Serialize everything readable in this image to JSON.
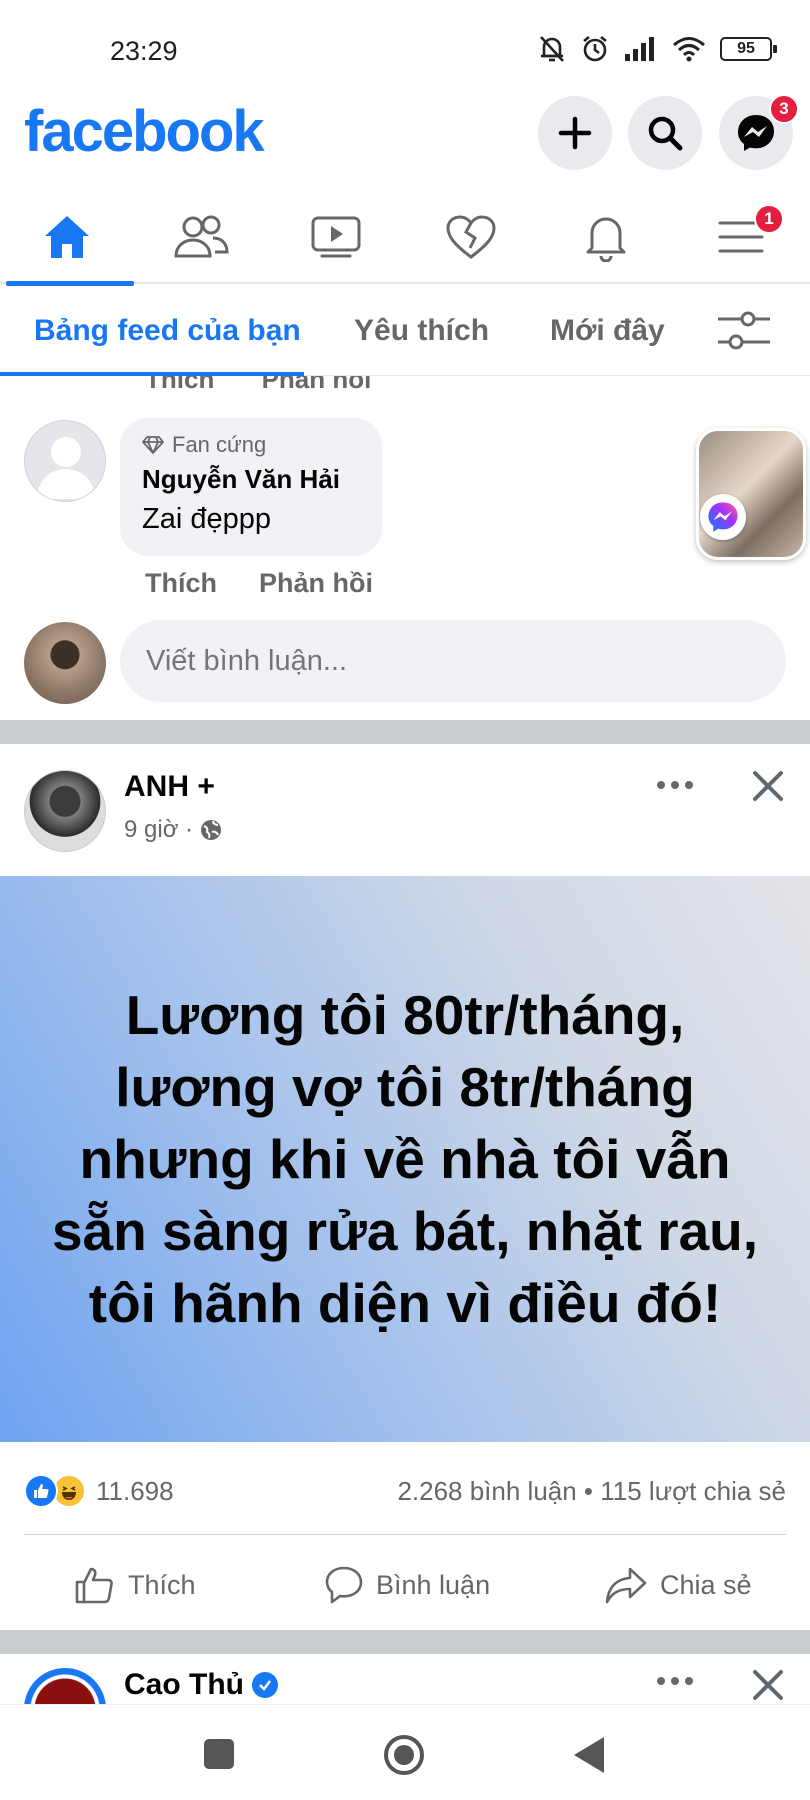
{
  "status_bar": {
    "time": "23:29",
    "battery": "95"
  },
  "header": {
    "logo": "facebook",
    "messenger_badge": "3"
  },
  "nav_tabs": {
    "menu_badge": "1"
  },
  "feed_filters": [
    {
      "label": "Bảng feed của bạn",
      "active": true
    },
    {
      "label": "Yêu thích",
      "active": false
    },
    {
      "label": "Mới đây",
      "active": false
    }
  ],
  "cut_off_actions": {
    "like": "Thích",
    "reply": "Phản hồi"
  },
  "comment": {
    "badge": "Fan cứng",
    "author": "Nguyễn Văn Hải",
    "text": "Zai đẹppp",
    "like_label": "Thích",
    "reply_label": "Phản hồi"
  },
  "comment_input": {
    "placeholder": "Viết bình luận..."
  },
  "post": {
    "author": "ANH +",
    "time": "9 giờ ·",
    "text": "Lương tôi 80tr/tháng, lương vợ tôi 8tr/tháng nhưng khi về nhà tôi vẫn sẵn sàng rửa bát, nhặt rau, tôi hãnh diện vì điều đó!",
    "reactions_count": "11.698",
    "stats": "2.268 bình luận • 115 lượt chia sẻ",
    "actions": {
      "like": "Thích",
      "comment": "Bình luận",
      "share": "Chia sẻ"
    }
  },
  "next_post": {
    "author": "Cao Thủ"
  },
  "colors": {
    "brand": "#1877f2",
    "badge": "#e41e3f",
    "muted": "#65676b",
    "bubble": "#f0f2f5"
  }
}
